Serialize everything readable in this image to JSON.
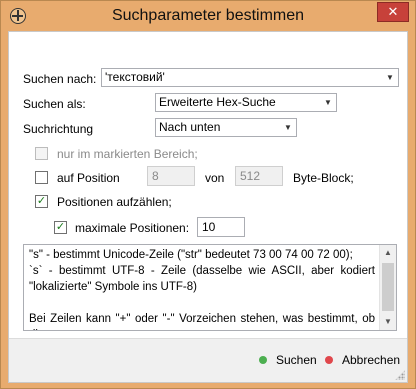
{
  "window": {
    "title": "Suchparameter bestimmen",
    "close_symbol": "✕"
  },
  "form": {
    "search_for_label": "Suchen nach:",
    "search_for_value": "'текстовий'",
    "search_as_label": "Suchen als:",
    "search_as_value": "Erweiterte Hex-Suche",
    "direction_label": "Suchrichtung",
    "direction_value": "Nach unten",
    "marked_area_label": "nur im markierten Bereich;",
    "marked_area_checked": false,
    "at_position_label": "auf Position",
    "at_position_checked": false,
    "position_value": "8",
    "of_label": "von",
    "block_value": "512",
    "byte_block_label": "Byte-Block;",
    "list_positions_label": "Positionen aufzählen;",
    "list_positions_checked": true,
    "max_positions_label": "maximale Positionen:",
    "max_positions_checked": true,
    "max_positions_value": "10"
  },
  "help": {
    "lines": [
      "\"s\" - bestimmt Unicode-Zeile (\"str\" bedeutet 73 00 74 00 72 00);",
      " `s` - bestimmt UTF-8 - Zeile (dasselbe wie ASCII, aber kodiert \"lokalizierte\" Symbole ins UTF-8)",
      "",
      "Bei Zeilen kann \"+\" oder \"-\" Vorzeichen stehen, was bestimmt, ob die"
    ]
  },
  "buttons": {
    "search_label": "Suchen",
    "cancel_label": "Abbrechen"
  },
  "colors": {
    "titlebar": "#e8ab6e",
    "close_button": "#c7413a",
    "search_dot": "#4caf50",
    "cancel_dot": "#e0474c",
    "check_mark": "#1a7a1a"
  },
  "icons": {
    "app": "crosshair-globe-icon",
    "combo_arrow": "▼",
    "check": "✓",
    "scroll_up": "▲",
    "scroll_down": "▼"
  }
}
